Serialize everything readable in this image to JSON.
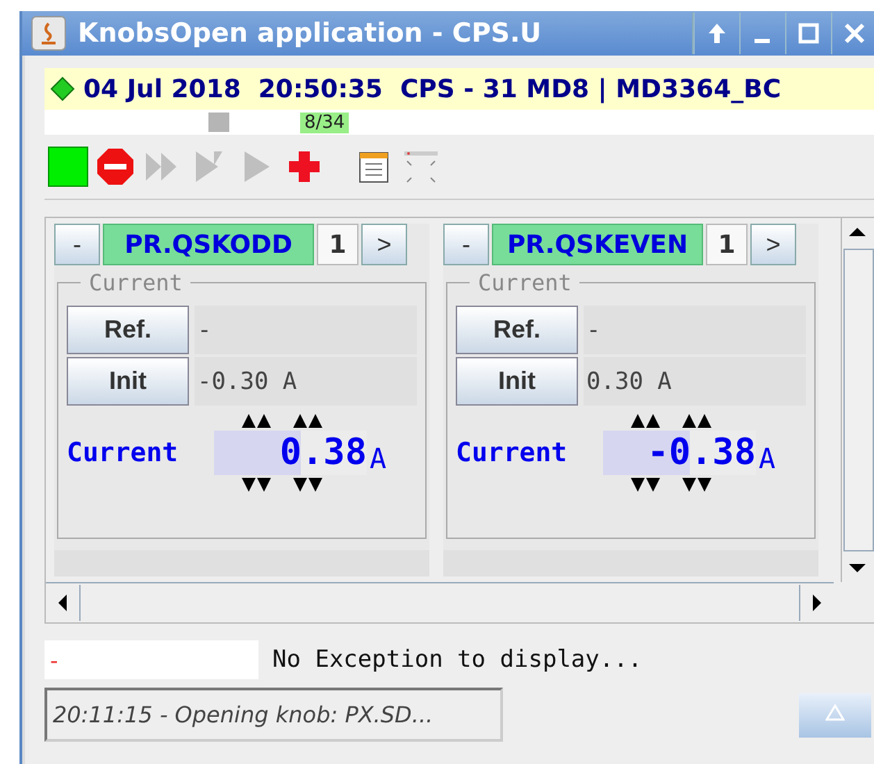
{
  "window": {
    "title": "KnobsOpen application - CPS.U"
  },
  "status": {
    "ok": true,
    "text": "04 Jul 2018  20:50:35  CPS - 31 MD8 | MD3364_BC"
  },
  "progress": {
    "level": 0.24,
    "counter": "8/34"
  },
  "toolbar": [
    {
      "kind": "run",
      "disabled": false
    },
    {
      "kind": "stop",
      "disabled": false
    },
    {
      "kind": "forward",
      "disabled": true
    },
    {
      "kind": "skip",
      "disabled": true
    },
    {
      "kind": "play",
      "disabled": true
    },
    {
      "kind": "add",
      "disabled": false
    },
    {
      "kind": "notes",
      "disabled": false
    },
    {
      "kind": "frame",
      "disabled": false
    }
  ],
  "knobs": [
    {
      "minus": "-",
      "name": "PR.QSKODD",
      "index": "1",
      "next": ">",
      "group": "Current",
      "ref_button": "Ref.",
      "ref": "-",
      "init_button": "Init",
      "init": "-0.30 A",
      "label": "Current",
      "value": "0.38",
      "unit": "A"
    },
    {
      "minus": "-",
      "name": "PR.QSKEVEN",
      "index": "1",
      "next": ">",
      "group": "Current",
      "ref_button": "Ref.",
      "ref": "-",
      "init_button": "Init",
      "init": "0.30 A",
      "label": "Current",
      "value": "-0.38",
      "unit": "A"
    }
  ],
  "exception": {
    "marker": "-",
    "text": "No Exception to display..."
  },
  "log": {
    "text": "20:11:15 - Opening knob: PX.SD..."
  }
}
